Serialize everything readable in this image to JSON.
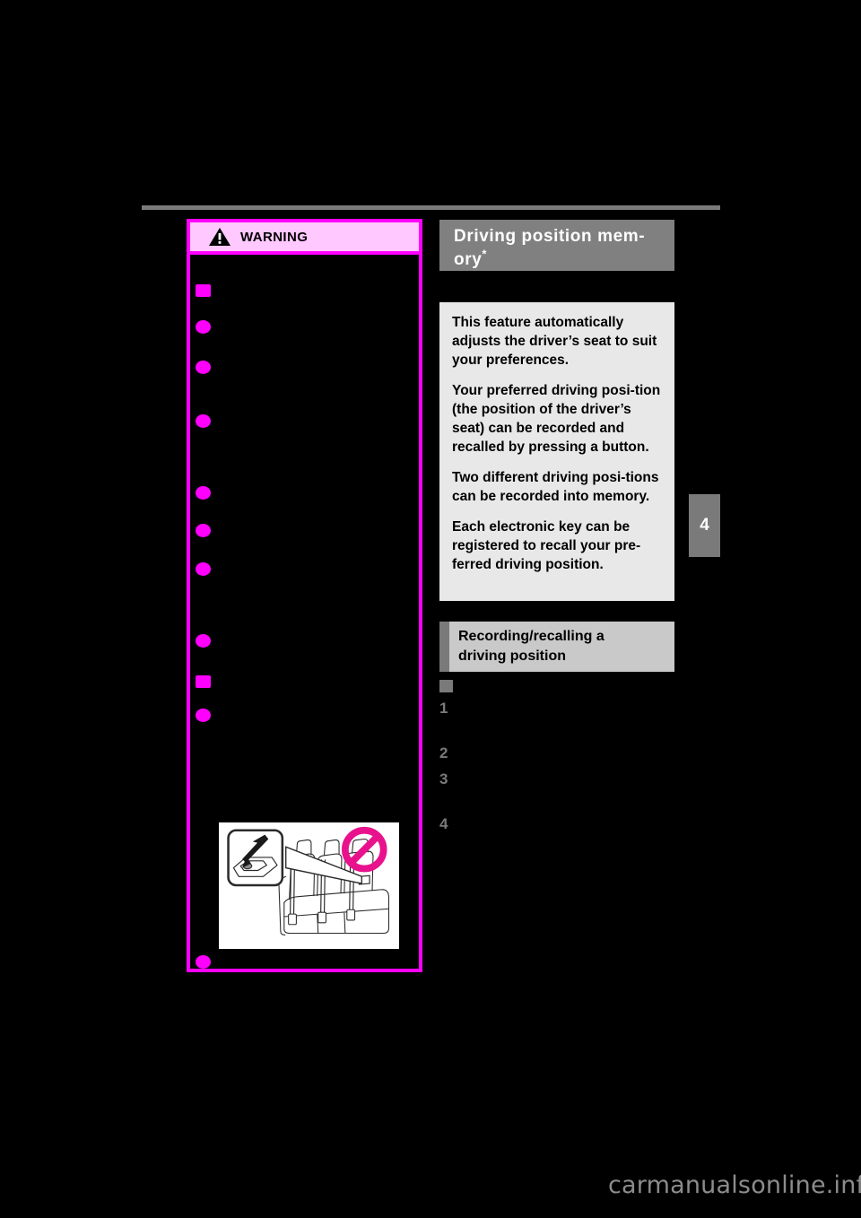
{
  "page": {
    "chapter_tab": "4",
    "watermark": "carmanualsonline.info"
  },
  "warning": {
    "title": "WARNING",
    "icon": "warning-triangle-icon",
    "border_color": "#ff00ff",
    "header_bg": "#ffc8ff",
    "bullets": [
      {
        "marker": "square",
        "text": ""
      },
      {
        "marker": "circle",
        "text": ""
      },
      {
        "marker": "circle",
        "text": ""
      },
      {
        "marker": "circle",
        "text": ""
      },
      {
        "marker": "circle",
        "text": ""
      },
      {
        "marker": "circle",
        "text": ""
      },
      {
        "marker": "circle",
        "text": ""
      },
      {
        "marker": "circle",
        "text": ""
      },
      {
        "marker": "square",
        "text": ""
      },
      {
        "marker": "circle",
        "text": ""
      },
      {
        "marker": "circle",
        "text": ""
      }
    ],
    "illustration": {
      "name": "seatbelt-buckle-prohibited-illustration",
      "prohibition_color": "#e8128c"
    }
  },
  "section": {
    "title": "Driving position mem-ory",
    "title_line1": "Driving position mem-",
    "title_line2": "ory",
    "footnote_marker": "*",
    "header_bg": "#808080"
  },
  "info": {
    "background": "#e8e8e8",
    "paragraphs": [
      "This feature automatically adjusts the driver’s seat to suit your preferences.",
      "Your preferred driving posi-tion (the position of the driver’s seat) can be recorded and recalled by pressing a button.",
      "Two different driving posi-tions can be recorded into memory.",
      "Each electronic key can be registered to recall your pre-ferred driving position."
    ]
  },
  "subsection": {
    "title_line1": "Recording/recalling a",
    "title_line2": "driving position",
    "background": "#c9c9c9",
    "bar_color": "#7a7a7a"
  },
  "procedure": {
    "heading": "",
    "steps": [
      {
        "number": "1",
        "text": ""
      },
      {
        "number": "2",
        "text": ""
      },
      {
        "number": "3",
        "text": ""
      },
      {
        "number": "4",
        "text": ""
      }
    ]
  }
}
